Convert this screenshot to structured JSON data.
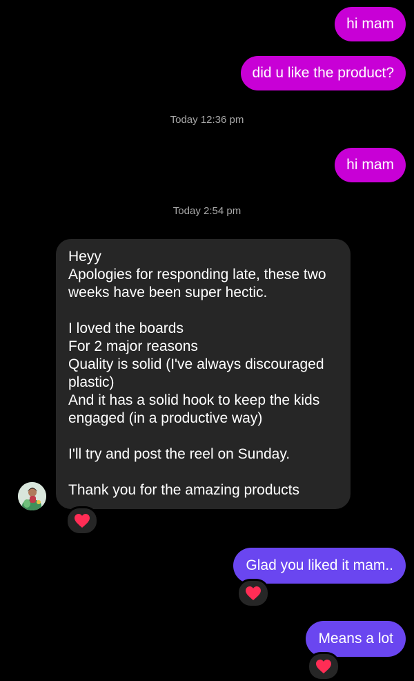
{
  "messages": {
    "m1": "hi mam",
    "m2": "did u like the product?",
    "ts1": "Today 12:36 pm",
    "m3": "hi mam",
    "ts2": "Today 2:54 pm",
    "incoming_lines": [
      "Heyy",
      "Apologies for responding late, these two weeks have been super hectic.",
      "",
      "I loved the boards",
      "For 2 major reasons",
      "Quality is solid (I've always discouraged plastic)",
      "And it has a solid hook to keep the kids engaged (in a productive way)",
      "",
      "I'll try and post the reel on Sunday.",
      "",
      "Thank you for the amazing products"
    ],
    "m5": "Glad you liked it mam..",
    "m6": "Means a lot"
  },
  "reactions": {
    "incoming": "heart-icon",
    "m5": "heart-icon",
    "m6": "heart-icon"
  },
  "colors": {
    "background": "#000000",
    "outgoing_pink": "#c800d6",
    "outgoing_purple": "#6a46f0",
    "incoming_bubble": "#262626",
    "timestamp": "#a8a8a8",
    "heart": "#ff2d55"
  }
}
